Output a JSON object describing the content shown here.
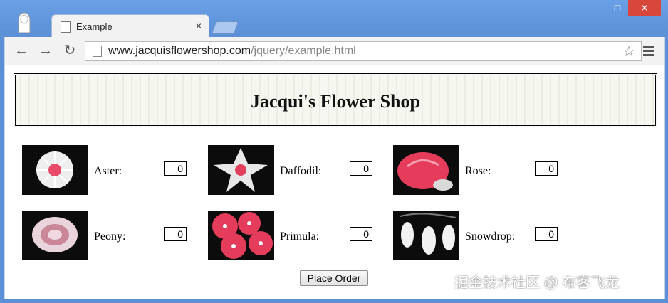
{
  "browser": {
    "tab_title": "Example",
    "tab_close": "×",
    "url_host": "www.jacquisflowershop.com",
    "url_path": "/jquery/example.html"
  },
  "page": {
    "heading": "Jacqui's Flower Shop",
    "flowers": [
      {
        "label": "Aster:",
        "value": "0"
      },
      {
        "label": "Daffodil:",
        "value": "0"
      },
      {
        "label": "Rose:",
        "value": "0"
      },
      {
        "label": "Peony:",
        "value": "0"
      },
      {
        "label": "Primula:",
        "value": "0"
      },
      {
        "label": "Snowdrop:",
        "value": "0"
      }
    ],
    "order_button": "Place Order"
  },
  "watermark": "掘金技术社区 @ 布客飞龙",
  "colors": {
    "accent": "#d9463b",
    "frame": "#5b8fd6"
  }
}
